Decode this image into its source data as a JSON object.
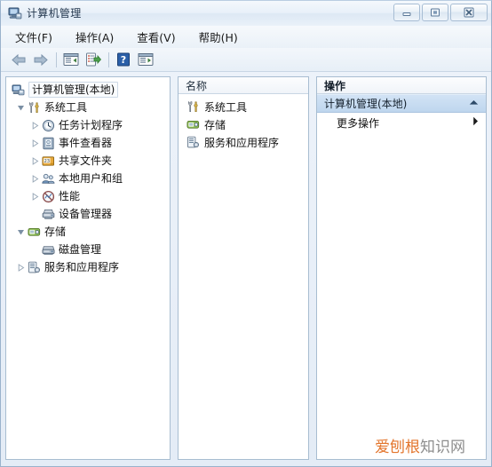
{
  "window": {
    "title": "计算机管理",
    "icon": "computer-management-icon",
    "controls": {
      "minimize": "minimize-icon",
      "maximize": "maximize-icon",
      "close": "close-icon"
    }
  },
  "menubar": {
    "items": [
      {
        "label": "文件(F)",
        "name": "menu-file"
      },
      {
        "label": "操作(A)",
        "name": "menu-action"
      },
      {
        "label": "查看(V)",
        "name": "menu-view"
      },
      {
        "label": "帮助(H)",
        "name": "menu-help"
      }
    ]
  },
  "toolbar": {
    "buttons": [
      {
        "name": "back-button",
        "icon": "back-arrow-icon"
      },
      {
        "name": "forward-button",
        "icon": "forward-arrow-icon"
      },
      {
        "name": "show-hide-console-tree-button",
        "icon": "console-tree-icon"
      },
      {
        "name": "export-list-button",
        "icon": "export-list-icon"
      },
      {
        "name": "help-button",
        "icon": "question-mark-icon"
      },
      {
        "name": "show-hide-action-pane-button",
        "icon": "action-pane-icon"
      }
    ]
  },
  "tree": {
    "items": [
      {
        "label": "计算机管理(本地)",
        "indent": 0,
        "twisty": "none",
        "icon": "computer-icon",
        "selected": true
      },
      {
        "label": "系统工具",
        "indent": 1,
        "twisty": "expanded",
        "icon": "system-tools-icon",
        "selected": false
      },
      {
        "label": "任务计划程序",
        "indent": 2,
        "twisty": "collapsed",
        "icon": "task-scheduler-icon",
        "selected": false
      },
      {
        "label": "事件查看器",
        "indent": 2,
        "twisty": "collapsed",
        "icon": "event-viewer-icon",
        "selected": false
      },
      {
        "label": "共享文件夹",
        "indent": 2,
        "twisty": "collapsed",
        "icon": "shared-folders-icon",
        "selected": false
      },
      {
        "label": "本地用户和组",
        "indent": 2,
        "twisty": "collapsed",
        "icon": "local-users-groups-icon",
        "selected": false
      },
      {
        "label": "性能",
        "indent": 2,
        "twisty": "collapsed",
        "icon": "performance-icon",
        "selected": false
      },
      {
        "label": "设备管理器",
        "indent": 2,
        "twisty": "none",
        "icon": "device-manager-icon",
        "selected": false
      },
      {
        "label": "存储",
        "indent": 1,
        "twisty": "expanded",
        "icon": "storage-icon",
        "selected": false
      },
      {
        "label": "磁盘管理",
        "indent": 2,
        "twisty": "none",
        "icon": "disk-management-icon",
        "selected": false
      },
      {
        "label": "服务和应用程序",
        "indent": 1,
        "twisty": "collapsed",
        "icon": "services-apps-icon",
        "selected": false
      }
    ]
  },
  "list": {
    "header": "名称",
    "rows": [
      {
        "label": "系统工具",
        "icon": "system-tools-icon"
      },
      {
        "label": "存储",
        "icon": "storage-icon"
      },
      {
        "label": "服务和应用程序",
        "icon": "services-apps-icon"
      }
    ]
  },
  "actions": {
    "header": "操作",
    "group_label": "计算机管理(本地)",
    "group_chevron": "chevron-up-icon",
    "rows": [
      {
        "label": "更多操作",
        "chevron": "chevron-right-icon"
      }
    ]
  },
  "watermark": {
    "text_accent": "爱刨根",
    "text_muted": "知识网",
    "accent_color": "#e3752c",
    "muted_color": "#8d8d8d"
  }
}
